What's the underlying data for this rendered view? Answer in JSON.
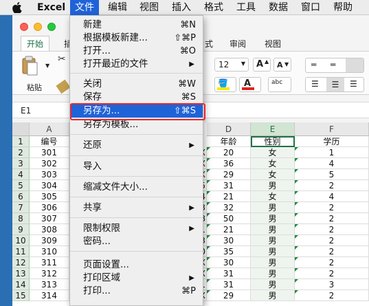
{
  "menubar": {
    "app": "Excel",
    "items": [
      "文件",
      "编辑",
      "视图",
      "插入",
      "格式",
      "工具",
      "数据",
      "窗口",
      "帮助"
    ],
    "active": "文件"
  },
  "ribbon": {
    "tabs": [
      "开始",
      "插",
      "局",
      "式",
      "数据",
      "审阅",
      "视图"
    ],
    "paste_label": "粘贴",
    "font_size": "12",
    "grow_font": "A",
    "shrink_font": "A",
    "abc_label": "abc"
  },
  "formula_bar": {
    "name_box": "E1"
  },
  "grid": {
    "columns": [
      "A",
      "D",
      "E",
      "F"
    ],
    "header_row": [
      "编号",
      "年龄",
      "性别",
      "学历"
    ],
    "row_numbers": [
      "1",
      "2",
      "3",
      "4",
      "5",
      "6",
      "7",
      "8",
      "9",
      "10",
      "11",
      "12",
      "13",
      "14",
      "15"
    ],
    "rows": [
      {
        "a": "301",
        "frag": "X",
        "d": "20",
        "e": "女",
        "f": "1"
      },
      {
        "a": "302",
        "frag": "X",
        "d": "36",
        "e": "女",
        "f": "4"
      },
      {
        "a": "303",
        "frag": "X",
        "d": "29",
        "e": "女",
        "f": "5"
      },
      {
        "a": "304",
        "frag": "5",
        "d": "31",
        "e": "男",
        "f": "2"
      },
      {
        "a": "305",
        "frag": "4",
        "d": "21",
        "e": "女",
        "f": "4"
      },
      {
        "a": "306",
        "frag": "3",
        "d": "32",
        "e": "男",
        "f": "2"
      },
      {
        "a": "307",
        "frag": "8",
        "d": "50",
        "e": "男",
        "f": "2"
      },
      {
        "a": "308",
        "frag": "1",
        "d": "21",
        "e": "男",
        "f": "2"
      },
      {
        "a": "309",
        "frag": "3",
        "d": "30",
        "e": "男",
        "f": "2"
      },
      {
        "a": "310",
        "frag": "0",
        "d": "35",
        "e": "男",
        "f": "2"
      },
      {
        "a": "311",
        "frag": "X",
        "d": "30",
        "e": "男",
        "f": "2"
      },
      {
        "a": "312",
        "frag": "X",
        "d": "31",
        "e": "男",
        "f": "2"
      },
      {
        "a": "313",
        "frag": "1",
        "d": "31",
        "e": "男",
        "f": "3"
      },
      {
        "a": "314",
        "frag": "X",
        "d": "29",
        "e": "男",
        "f": "2"
      }
    ]
  },
  "file_menu": {
    "items": [
      {
        "label": "新建",
        "shortcut": "⌘N"
      },
      {
        "label": "根据模板新建...",
        "shortcut": "⇧⌘P"
      },
      {
        "label": "打开...",
        "shortcut": "⌘O"
      },
      {
        "label": "打开最近的文件",
        "arrow": "▶"
      },
      {
        "label": "关闭",
        "shortcut": "⌘W"
      },
      {
        "label": "保存",
        "shortcut": "⌘S"
      },
      {
        "label": "另存为...",
        "shortcut": "⇧⌘S"
      },
      {
        "label": "另存为模板..."
      },
      {
        "label": "还原",
        "arrow": "▶"
      },
      {
        "label": "导入"
      },
      {
        "label": "缩减文件大小..."
      },
      {
        "label": "共享",
        "arrow": "▶"
      },
      {
        "label": "限制权限",
        "arrow": "▶"
      },
      {
        "label": "密码..."
      },
      {
        "label": "页面设置..."
      },
      {
        "label": "打印区域",
        "arrow": "▶"
      },
      {
        "label": "打印...",
        "shortcut": "⌘P"
      }
    ],
    "highlighted": "另存为..."
  },
  "colors": {
    "menu_highlight": "#1f63d9",
    "highlight_ring": "#e8262c",
    "excel_green": "#1e7145"
  }
}
